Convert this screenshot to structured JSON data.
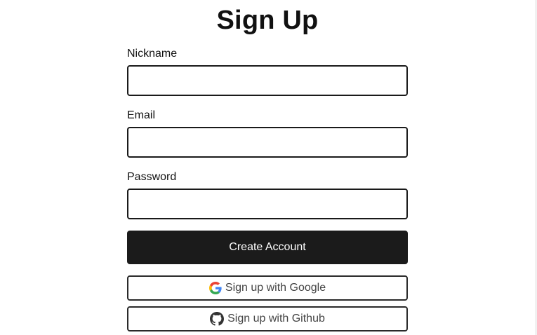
{
  "page": {
    "title": "Sign Up"
  },
  "form": {
    "fields": [
      {
        "label": "Nickname",
        "value": "",
        "placeholder": ""
      },
      {
        "label": "Email",
        "value": "",
        "placeholder": ""
      },
      {
        "label": "Password",
        "value": "",
        "placeholder": ""
      }
    ],
    "submit_label": "Create Account",
    "google_label": "Sign up with Google",
    "github_label": "Sign up with Github"
  },
  "icons": {
    "google": "google-icon",
    "github": "github-icon"
  },
  "colors": {
    "primary_button": "#1b1b1b",
    "primary_text": "#ffffff",
    "border": "#1a1a1a",
    "google_blue": "#4285F4",
    "google_red": "#EA4335",
    "google_yellow": "#FBBC05",
    "google_green": "#34A853"
  }
}
